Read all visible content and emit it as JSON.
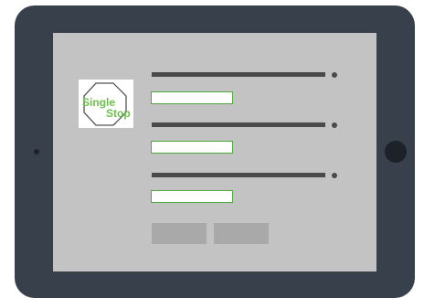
{
  "logo": {
    "line1": "Single",
    "line2": "Stop",
    "mark": "™",
    "shape": "octagon-icon",
    "text_color": "#6cc24a"
  },
  "form": {
    "fields": [
      {
        "label": "",
        "required": true,
        "value": ""
      },
      {
        "label": "",
        "required": true,
        "value": ""
      },
      {
        "label": "",
        "required": true,
        "value": ""
      }
    ],
    "buttons": [
      {
        "label": ""
      },
      {
        "label": ""
      }
    ]
  },
  "colors": {
    "device_frame": "#38414b",
    "screen": "#c3c3c3",
    "input_border": "#4fa83d",
    "button": "#a9a9a9"
  }
}
